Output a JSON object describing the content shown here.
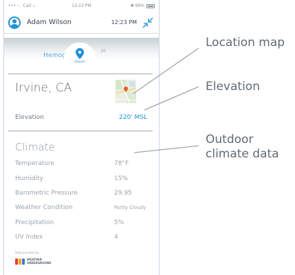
{
  "status_bar": {
    "carrier": "•••◦◦ Call ᵤ",
    "time": "12:23 PM",
    "battery": "✱ 99%"
  },
  "header": {
    "user_name": "Adam Wilson",
    "time": "12:23 PM"
  },
  "hemoglobin": {
    "label": "Hemoglo",
    "value": "20"
  },
  "details_label": "Details",
  "location": {
    "name": "Irvine, CA",
    "elevation_label": "Elevation",
    "elevation_value": "220' MSL"
  },
  "climate": {
    "title": "Climate",
    "rows": [
      {
        "label": "Temperature",
        "value": "78°F"
      },
      {
        "label": "Humidity",
        "value": "15%"
      },
      {
        "label": "Barometric Pressure",
        "value": "29.95"
      },
      {
        "label": "Weather Condition",
        "value": "Partly Cloudy"
      },
      {
        "label": "Precipitation",
        "value": "5%"
      },
      {
        "label": "UV Index",
        "value": "4"
      }
    ],
    "powered_by": "Data provided by",
    "provider_line1": "WEATHER",
    "provider_line2": "UNDERGROUND"
  },
  "callouts": {
    "location_map": "Location map",
    "elevation": "Elevation",
    "outdoor_line1": "Outdoor",
    "outdoor_line2": "climate data"
  },
  "colors": {
    "accent": "#1c8fd8",
    "text_dark": "#3a4450",
    "text_muted": "#9aa4ac"
  }
}
